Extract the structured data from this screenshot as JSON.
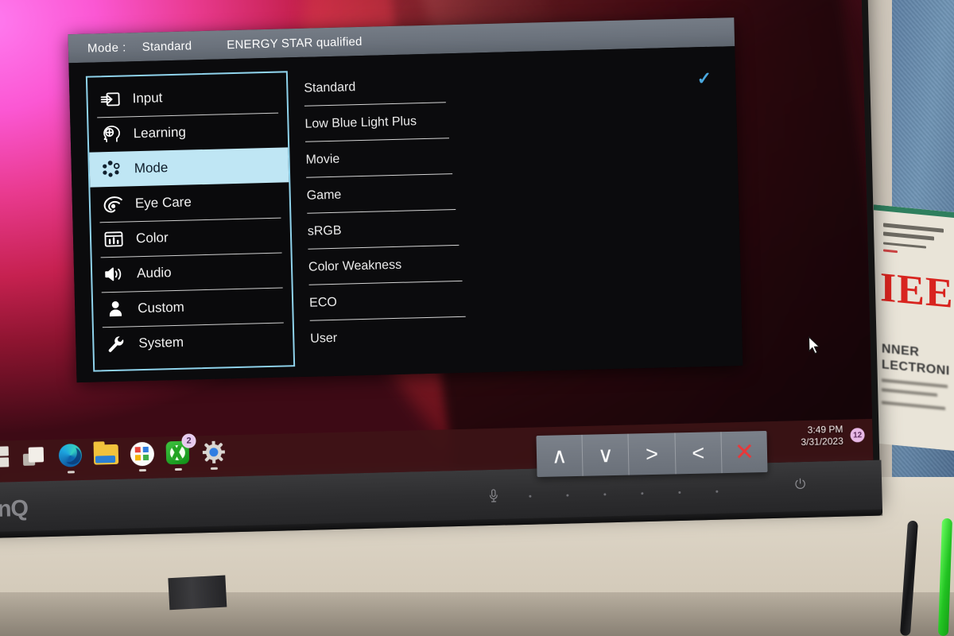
{
  "osd": {
    "header": {
      "mode_label": "Mode :",
      "mode_value": "Standard",
      "energy_star": "ENERGY STAR qualified"
    },
    "menu_items": [
      {
        "label": "Input",
        "icon": "input-icon",
        "active": false
      },
      {
        "label": "Learning",
        "icon": "learning-icon",
        "active": false
      },
      {
        "label": "Mode",
        "icon": "mode-icon",
        "active": true
      },
      {
        "label": "Eye Care",
        "icon": "eye-care-icon",
        "active": false
      },
      {
        "label": "Color",
        "icon": "color-icon",
        "active": false
      },
      {
        "label": "Audio",
        "icon": "audio-icon",
        "active": false
      },
      {
        "label": "Custom",
        "icon": "custom-icon",
        "active": false
      },
      {
        "label": "System",
        "icon": "system-icon",
        "active": false
      }
    ],
    "options": [
      {
        "label": "Standard",
        "selected": true
      },
      {
        "label": "Low Blue Light Plus",
        "selected": false
      },
      {
        "label": "Movie",
        "selected": false
      },
      {
        "label": "Game",
        "selected": false
      },
      {
        "label": "sRGB",
        "selected": false
      },
      {
        "label": "Color Weakness",
        "selected": false
      },
      {
        "label": "ECO",
        "selected": false
      },
      {
        "label": "User",
        "selected": false
      }
    ],
    "check_glyph": "✓",
    "keybar": [
      {
        "name": "up-button",
        "glyph": "∧"
      },
      {
        "name": "down-button",
        "glyph": "∨"
      },
      {
        "name": "right-button",
        "glyph": ">"
      },
      {
        "name": "left-button",
        "glyph": "<"
      },
      {
        "name": "close-button",
        "glyph": "✕"
      }
    ],
    "colors": {
      "border": "#8fd3ec",
      "highlight": "#bfe6f4",
      "check": "#4aa8df",
      "close": "#e8383a"
    }
  },
  "taskbar": {
    "icons": [
      {
        "name": "start-icon",
        "label": "Start"
      },
      {
        "name": "task-view-icon",
        "label": "Task View"
      },
      {
        "name": "edge-icon",
        "label": "Microsoft Edge"
      },
      {
        "name": "file-explorer-icon",
        "label": "File Explorer"
      },
      {
        "name": "office-icon",
        "label": "Microsoft 365"
      },
      {
        "name": "xbox-icon",
        "label": "Xbox",
        "badge": "2"
      },
      {
        "name": "settings-gear-icon",
        "label": "Settings"
      }
    ],
    "clock": {
      "time": "3:49 PM",
      "date": "3/31/2023"
    },
    "notification_badge": "12"
  },
  "monitor": {
    "brand": "enQ",
    "mic_glyph": "Ἲ4",
    "power_glyph": "⏻"
  },
  "background": {
    "poster_headline": "IEE",
    "poster_sub1": "NNER",
    "poster_sub2": "LECTRONI"
  }
}
